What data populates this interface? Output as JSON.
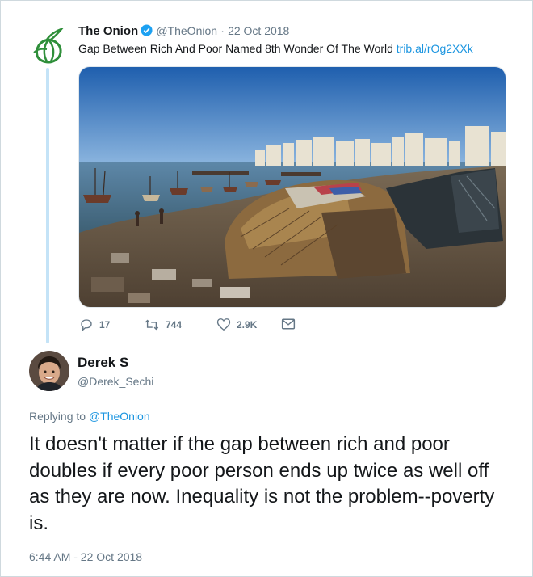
{
  "original_tweet": {
    "author_name": "The Onion",
    "handle": "@TheOnion",
    "separator": "·",
    "date": "22 Oct 2018",
    "text": "Gap Between Rich And Poor Named 8th Wonder Of The World",
    "link": "trib.al/rOg2XXk",
    "actions": {
      "replies": "17",
      "retweets": "744",
      "likes": "2.9K"
    },
    "icons": [
      "onion-logo-icon",
      "verified-badge-icon",
      "reply-icon",
      "retweet-icon",
      "like-heart-icon",
      "direct-message-icon"
    ]
  },
  "reply_tweet": {
    "author_name": "Derek S",
    "handle": "@Derek_Sechi",
    "replying_prefix": "Replying to",
    "replying_to": "@TheOnion",
    "text": "It doesn't matter if the gap between rich and poor doubles if every poor person ends up twice as well off as they are now. Inequality is not the problem--poverty is.",
    "timestamp": "6:44 AM - 22 Oct 2018"
  },
  "colors": {
    "link": "#1b95e0",
    "muted": "#657786",
    "thread_line": "#c4e3f7",
    "onion_green": "#2f8f3a"
  }
}
